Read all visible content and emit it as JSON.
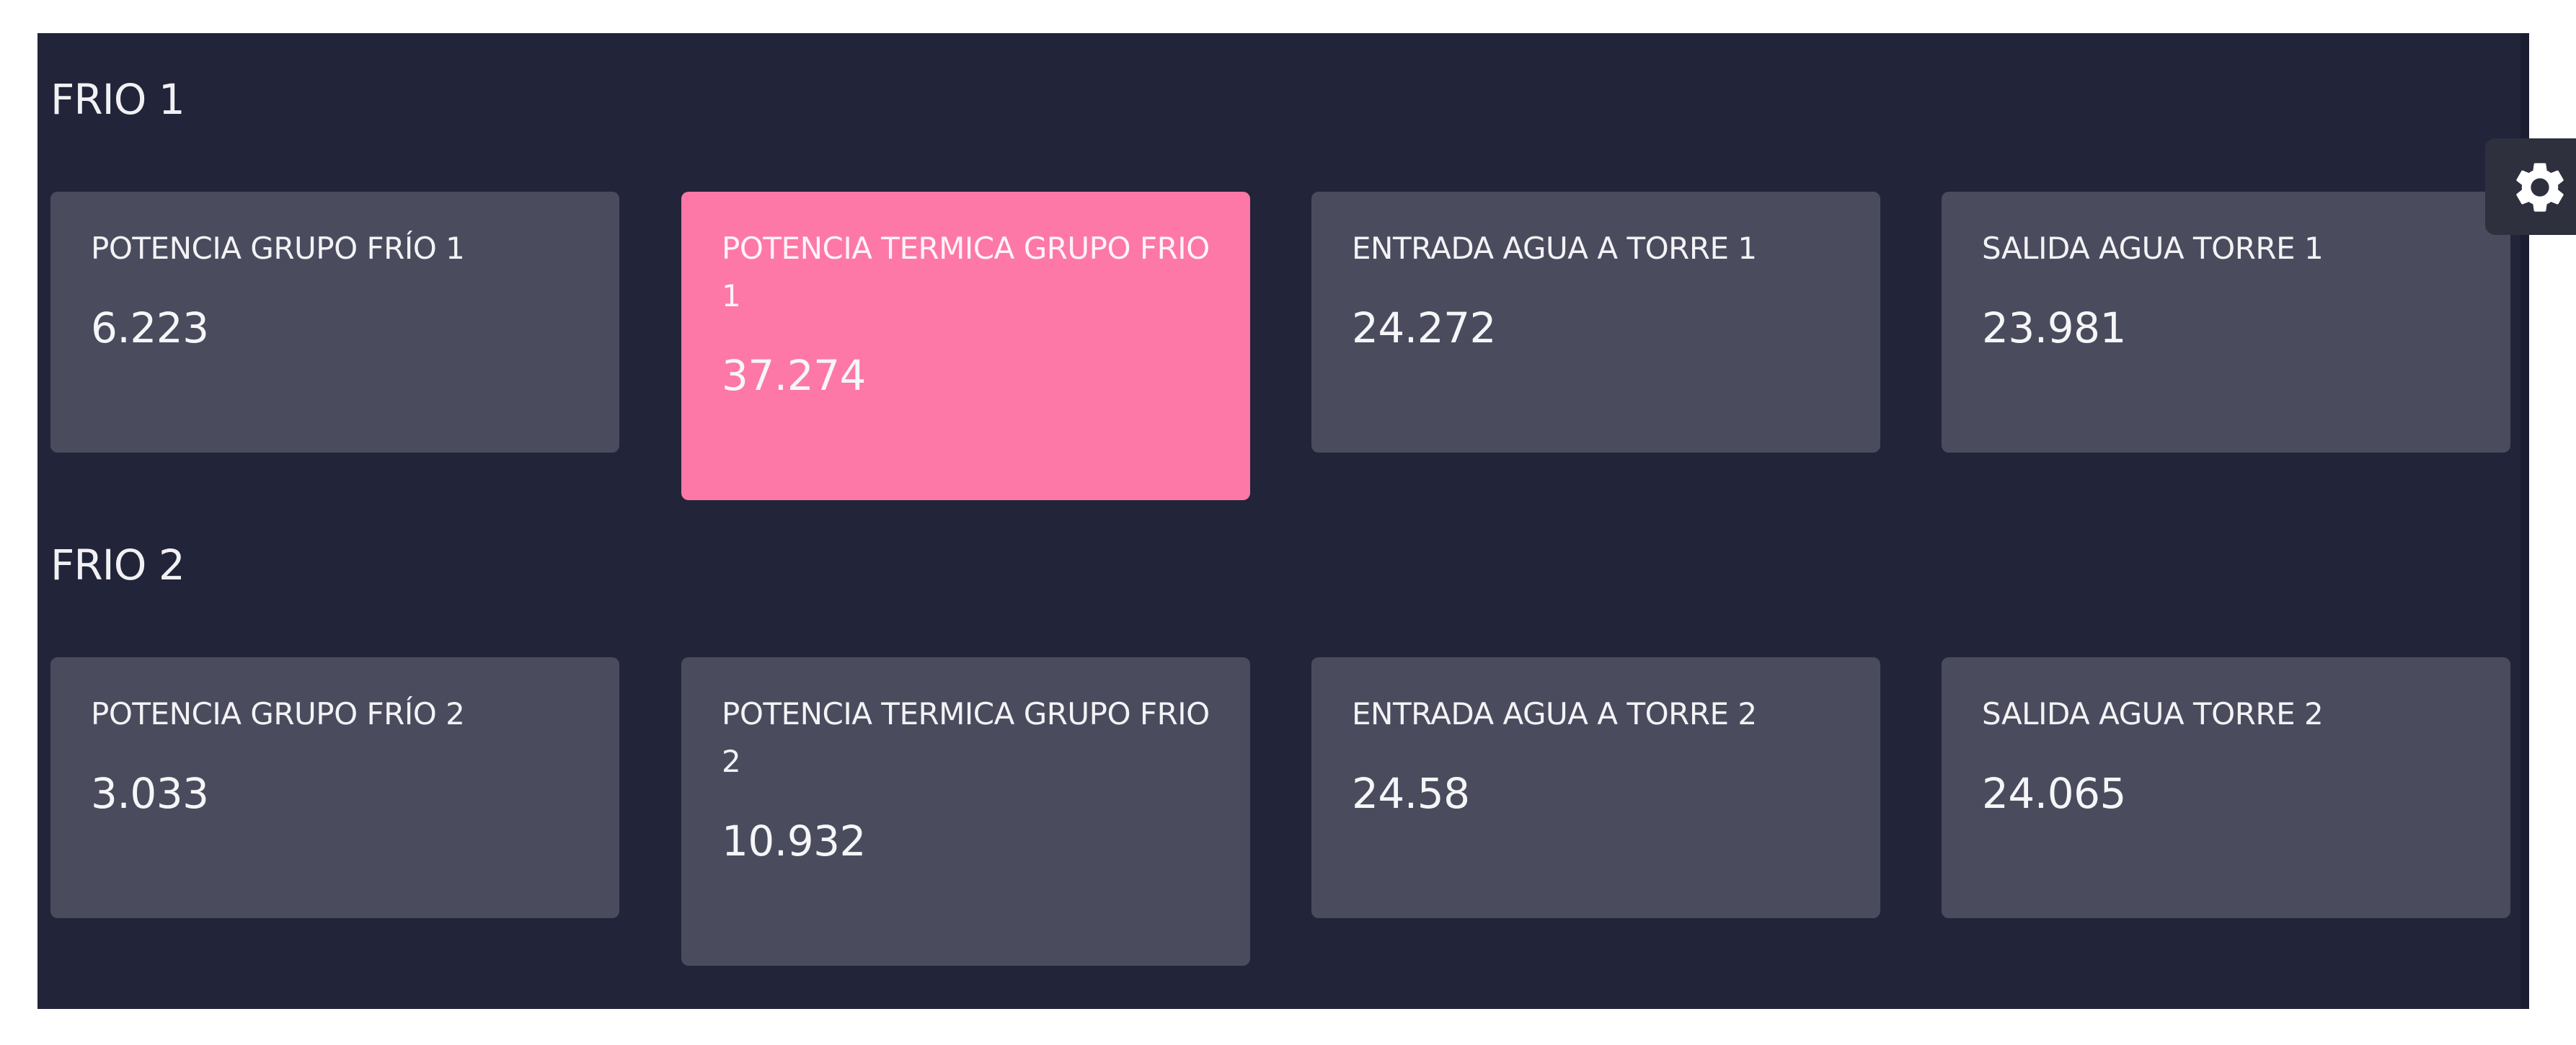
{
  "sections": [
    {
      "title": "FRIO 1",
      "cards": [
        {
          "label": "POTENCIA GRUPO FRÍO 1",
          "value": "6.223"
        },
        {
          "label": "POTENCIA TERMICA GRUPO FRIO 1",
          "value": "37.274"
        },
        {
          "label": "ENTRADA AGUA A TORRE 1",
          "value": "24.272"
        },
        {
          "label": "SALIDA AGUA TORRE 1",
          "value": "23.981"
        }
      ]
    },
    {
      "title": "FRIO 2",
      "cards": [
        {
          "label": "POTENCIA GRUPO FRÍO 2",
          "value": "3.033"
        },
        {
          "label": "POTENCIA TERMICA GRUPO FRIO 2",
          "value": "10.932"
        },
        {
          "label": "ENTRADA AGUA A TORRE 2",
          "value": "24.58"
        },
        {
          "label": "SALIDA AGUA TORRE 2",
          "value": "24.065"
        }
      ]
    }
  ],
  "settings": {
    "icon": "gear-icon"
  },
  "colors": {
    "background": "#22243a",
    "card": "#4a4c5e",
    "highlight_card": "#fd78a6",
    "text": "#ffffff"
  }
}
